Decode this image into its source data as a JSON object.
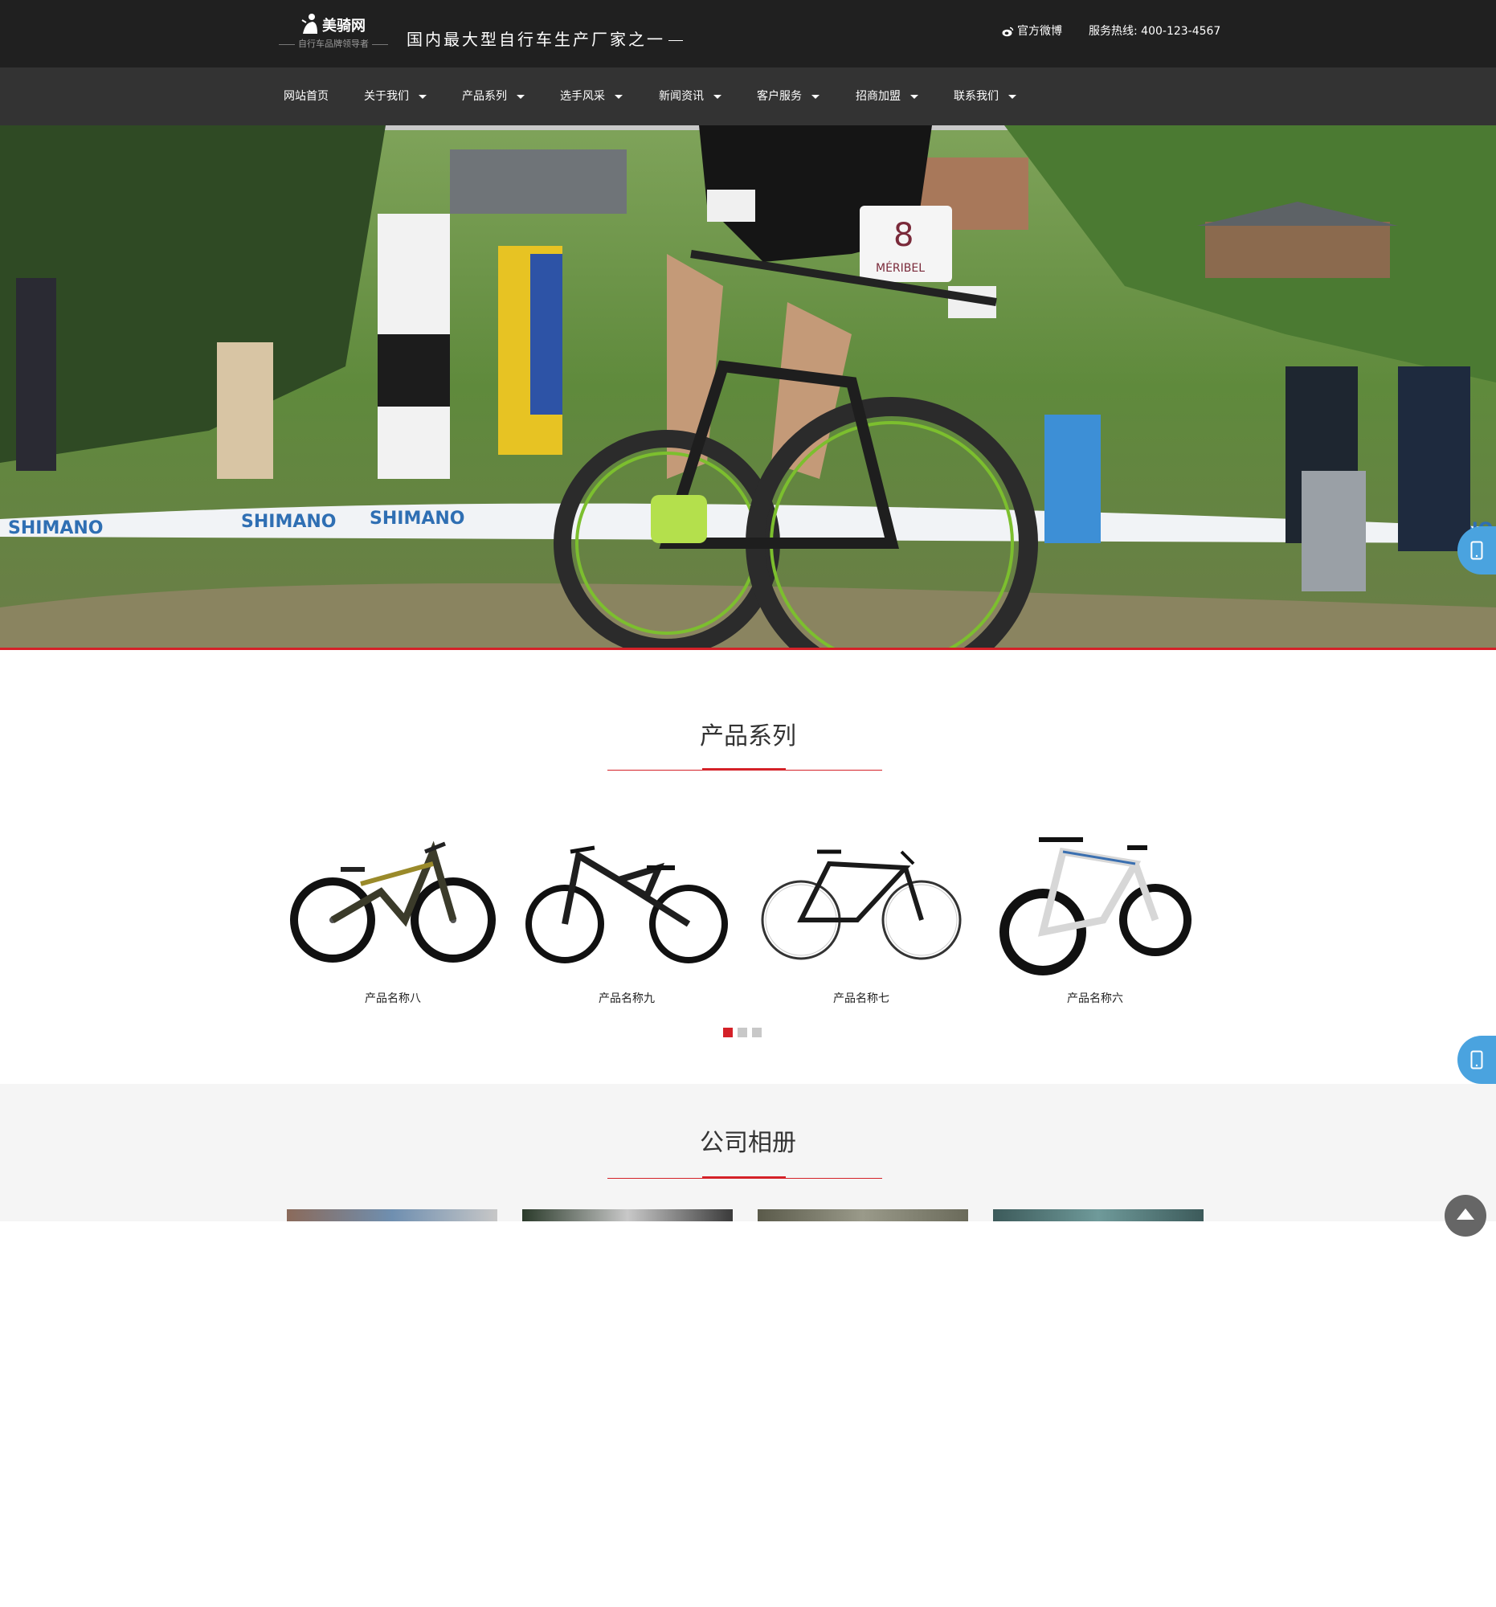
{
  "header": {
    "brand": "美骑网",
    "tagline": "自行车品牌领导者",
    "slogan": "国内最大型自行车生产厂家之一",
    "weibo_label": "官方微博",
    "hotline": "服务热线: 400-123-4567"
  },
  "nav": {
    "items": [
      {
        "label": "网站首页",
        "dropdown": false
      },
      {
        "label": "关于我们",
        "dropdown": true
      },
      {
        "label": "产品系列",
        "dropdown": true
      },
      {
        "label": "选手风采",
        "dropdown": true
      },
      {
        "label": "新闻资讯",
        "dropdown": true
      },
      {
        "label": "客户服务",
        "dropdown": true
      },
      {
        "label": "招商加盟",
        "dropdown": true
      },
      {
        "label": "联系我们",
        "dropdown": true
      }
    ]
  },
  "hero": {
    "banner_texts": [
      "SHIMANO",
      "SHIMANO",
      "SHIMANO",
      "SHIMANO"
    ],
    "bib_number": "8",
    "bib_text": "MÉRIBEL"
  },
  "products": {
    "title": "产品系列",
    "items": [
      {
        "name": "产品名称八"
      },
      {
        "name": "产品名称九"
      },
      {
        "name": "产品名称七"
      },
      {
        "name": "产品名称六"
      }
    ],
    "carousel_pages": 3,
    "active_page": 1
  },
  "gallery": {
    "title": "公司相册"
  },
  "icons": {
    "weibo": "weibo-icon",
    "mobile": "mobile-phone-icon",
    "back_to_top": "arrow-up-icon",
    "caret": "caret-down-icon"
  },
  "colors": {
    "accent": "#d42128",
    "header_bg": "#202020",
    "nav_bg": "#333333",
    "float_button": "#4aa3df",
    "gallery_bg": "#f5f5f5"
  }
}
